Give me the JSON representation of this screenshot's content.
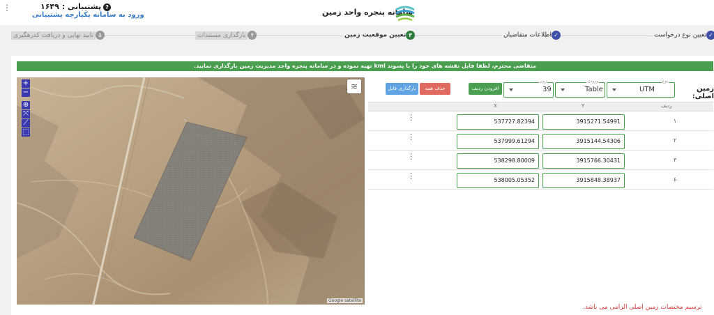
{
  "header": {
    "title": "سامانه پنجره واحد زمین",
    "support_label": "پشتیبانی : ۱۶۴۹",
    "support_link": "ورود به سامانه یکپارچه پشتیبانی",
    "icons": [
      "kebab-menu-icon",
      "question-circle-icon",
      "logo"
    ]
  },
  "steps": [
    {
      "label": "تعیین نوع درخواست",
      "state": "done",
      "mark": "✓"
    },
    {
      "label": "اطلاعات متقاضیان",
      "state": "done",
      "mark": "✓"
    },
    {
      "label": "تعیین موقعیت زمین",
      "state": "current",
      "mark": "۳"
    },
    {
      "label": "بارگذاری مستندات",
      "state": "todo",
      "mark": "۴"
    },
    {
      "label": "تایید نهایی و دریافت کدرهگیری",
      "state": "todo",
      "mark": "۵"
    }
  ],
  "banner": "متقاضی محترم، لطفا فایل نقشه های خود را با پسوند kml تهیه نموده و در سامانه پنجره واحد مدیریت زمین بارگذاری نمایید.",
  "map": {
    "attribution": "Google satellite",
    "controls": [
      "+",
      "−"
    ],
    "tool_icons": [
      "compass-icon",
      "fullscreen-icon",
      "draw-line-icon",
      "draw-polygon-icon"
    ],
    "layers_icon": "layers-icon"
  },
  "form": {
    "main_land_label": "زمین اصلی:",
    "type": {
      "legend": "نوع",
      "value": "UTM"
    },
    "input": {
      "legend": "ورودی",
      "value": "Table"
    },
    "zone": {
      "legend": "زون",
      "value": "39"
    },
    "buttons": {
      "add_row": "افزودن ردیف",
      "delete_all": "حذف همه",
      "upload_file": "بارگذاری فایل"
    },
    "colors": {
      "green": "#4a9e50",
      "red": "#e06a5f",
      "blue": "#5fa3e3"
    }
  },
  "table": {
    "headers": {
      "row": "ردیف",
      "y": "Y",
      "x": "X"
    },
    "rows": [
      {
        "num": "۱",
        "y": "3915271.54991",
        "x": "537727.82394"
      },
      {
        "num": "۲",
        "y": "3915144.54306",
        "x": "537999.61294"
      },
      {
        "num": "۳",
        "y": "3915766.30431",
        "x": "538298.80009"
      },
      {
        "num": "٤",
        "y": "3915848.38937",
        "x": "538005.05352"
      }
    ]
  },
  "error": "ترسیم مختصات زمین اصلی الزامی می باشد."
}
